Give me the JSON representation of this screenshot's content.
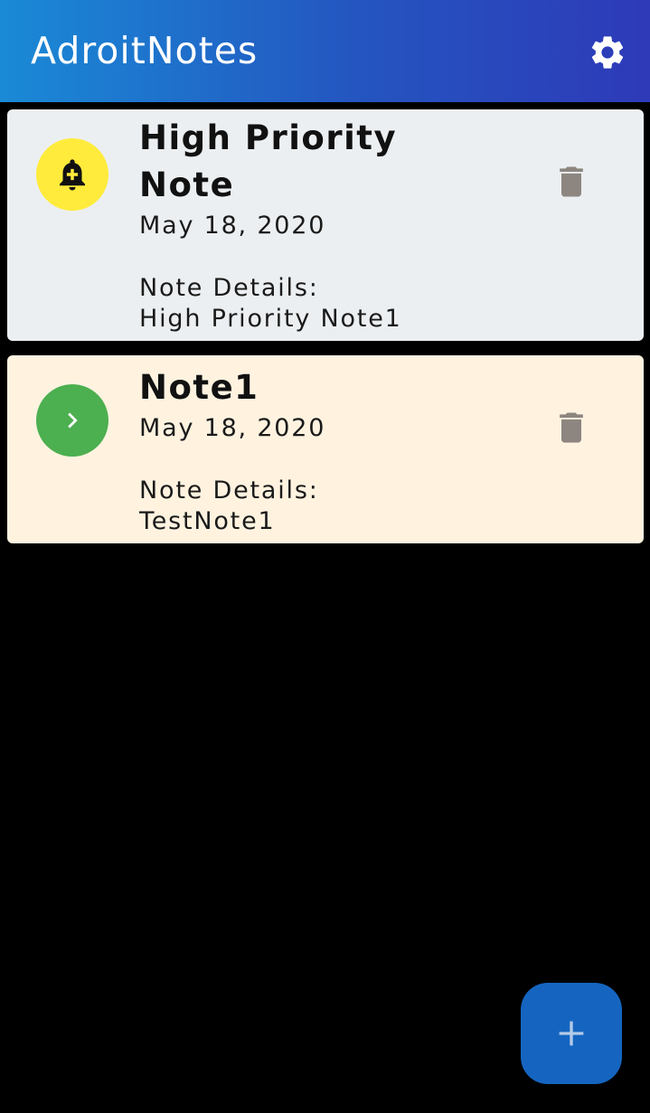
{
  "app_bar": {
    "title": "AdroitNotes",
    "settings_icon": "gear-icon",
    "gradient_start": "#1a8ad6",
    "gradient_end": "#2e3ab8"
  },
  "notes": [
    {
      "title": "High Priority Note",
      "date": "May 18, 2020",
      "details_label": "Note Details:",
      "details": "High Priority Note1",
      "priority": "high",
      "icon": "bell-plus-icon",
      "icon_bg": "#ffeb3b",
      "card_bg": "#eceff1",
      "delete_icon": "trash-icon"
    },
    {
      "title": "Note1",
      "date": "May 18, 2020",
      "details_label": "Note Details:",
      "details": "TestNote1",
      "priority": "normal",
      "icon": "chevron-right-icon",
      "icon_bg": "#4caf50",
      "card_bg": "#fff3e0",
      "delete_icon": "trash-icon"
    }
  ],
  "fab": {
    "icon": "plus-icon",
    "color": "#1565c0"
  }
}
